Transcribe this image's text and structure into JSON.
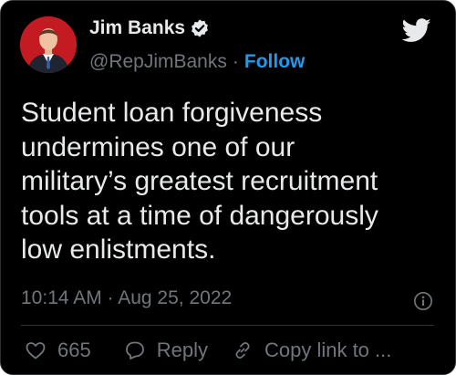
{
  "author": {
    "display_name": "Jim Banks",
    "handle": "@RepJimBanks",
    "separator": "·",
    "follow_label": "Follow"
  },
  "tweet": {
    "text": "Student loan forgiveness\nundermines one of our\nmilitary’s greatest recruitment\ntools at a time of dangerously\nlow enlistments.",
    "timestamp": "10:14 AM · Aug 25, 2022"
  },
  "actions": {
    "like_count": "665",
    "reply_label": "Reply",
    "copy_link_label": "Copy link to ..."
  },
  "icons": {
    "verified": "verified-badge-icon",
    "platform": "twitter-bird-icon",
    "info": "info-icon",
    "like": "heart-icon",
    "reply": "speech-bubble-icon",
    "copy": "link-icon"
  },
  "colors": {
    "background": "#000000",
    "text_primary": "#e7e9ea",
    "text_secondary": "#71767b",
    "accent": "#1d9bf0",
    "avatar_bg": "#c41a22"
  }
}
